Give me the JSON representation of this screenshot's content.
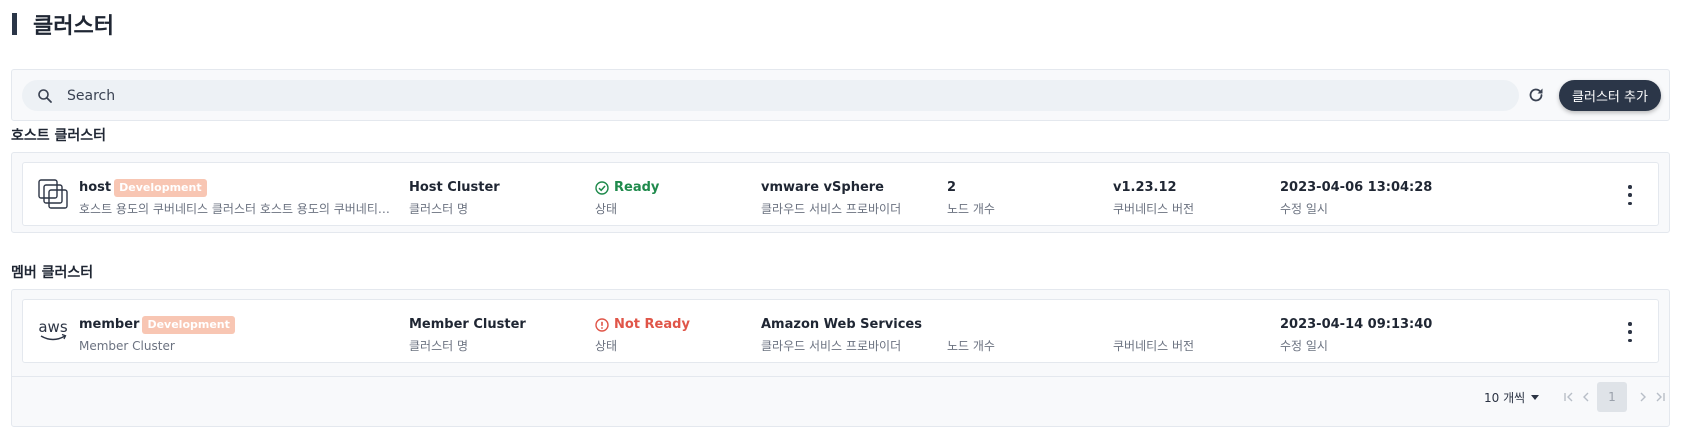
{
  "page": {
    "title": "클러스터"
  },
  "toolbar": {
    "search_placeholder": "Search",
    "search_value": "",
    "add_button_label": "클러스터 추가"
  },
  "host_section": {
    "title": "호스트 클러스터",
    "cluster": {
      "name": "host",
      "badge": "Development",
      "description": "호스트 용도의 쿠버네티스 클러스터 호스트 용도의 쿠버네티스…",
      "type": "Host Cluster",
      "type_label": "클러스터 명",
      "status": "Ready",
      "status_label": "상태",
      "provider": "vmware vSphere",
      "provider_label": "클라우드 서비스 프로바이더",
      "nodes": "2",
      "nodes_label": "노드 개수",
      "version": "v1.23.12",
      "version_label": "쿠버네티스 버전",
      "modified": "2023-04-06 13:04:28",
      "modified_label": "수정 일시"
    }
  },
  "member_section": {
    "title": "멤버 클러스터",
    "cluster": {
      "name": "member",
      "badge": "Development",
      "description": "Member Cluster",
      "type": "Member Cluster",
      "type_label": "클러스터 명",
      "status": "Not Ready",
      "status_label": "상태",
      "provider": "Amazon Web Services",
      "provider_label": "클라우드 서비스 프로바이더",
      "nodes": "",
      "nodes_label": "노드 개수",
      "version": "",
      "version_label": "쿠버네티스 버전",
      "modified": "2023-04-14 09:13:40",
      "modified_label": "수정 일시",
      "logo_text": "aws"
    },
    "pagination": {
      "per_page": "10 개씩",
      "current_page": "1"
    }
  },
  "colors": {
    "primary": "#2b3648",
    "ready": "#1f8a4c",
    "not_ready": "#e05548",
    "badge": "#f8c6b3"
  }
}
